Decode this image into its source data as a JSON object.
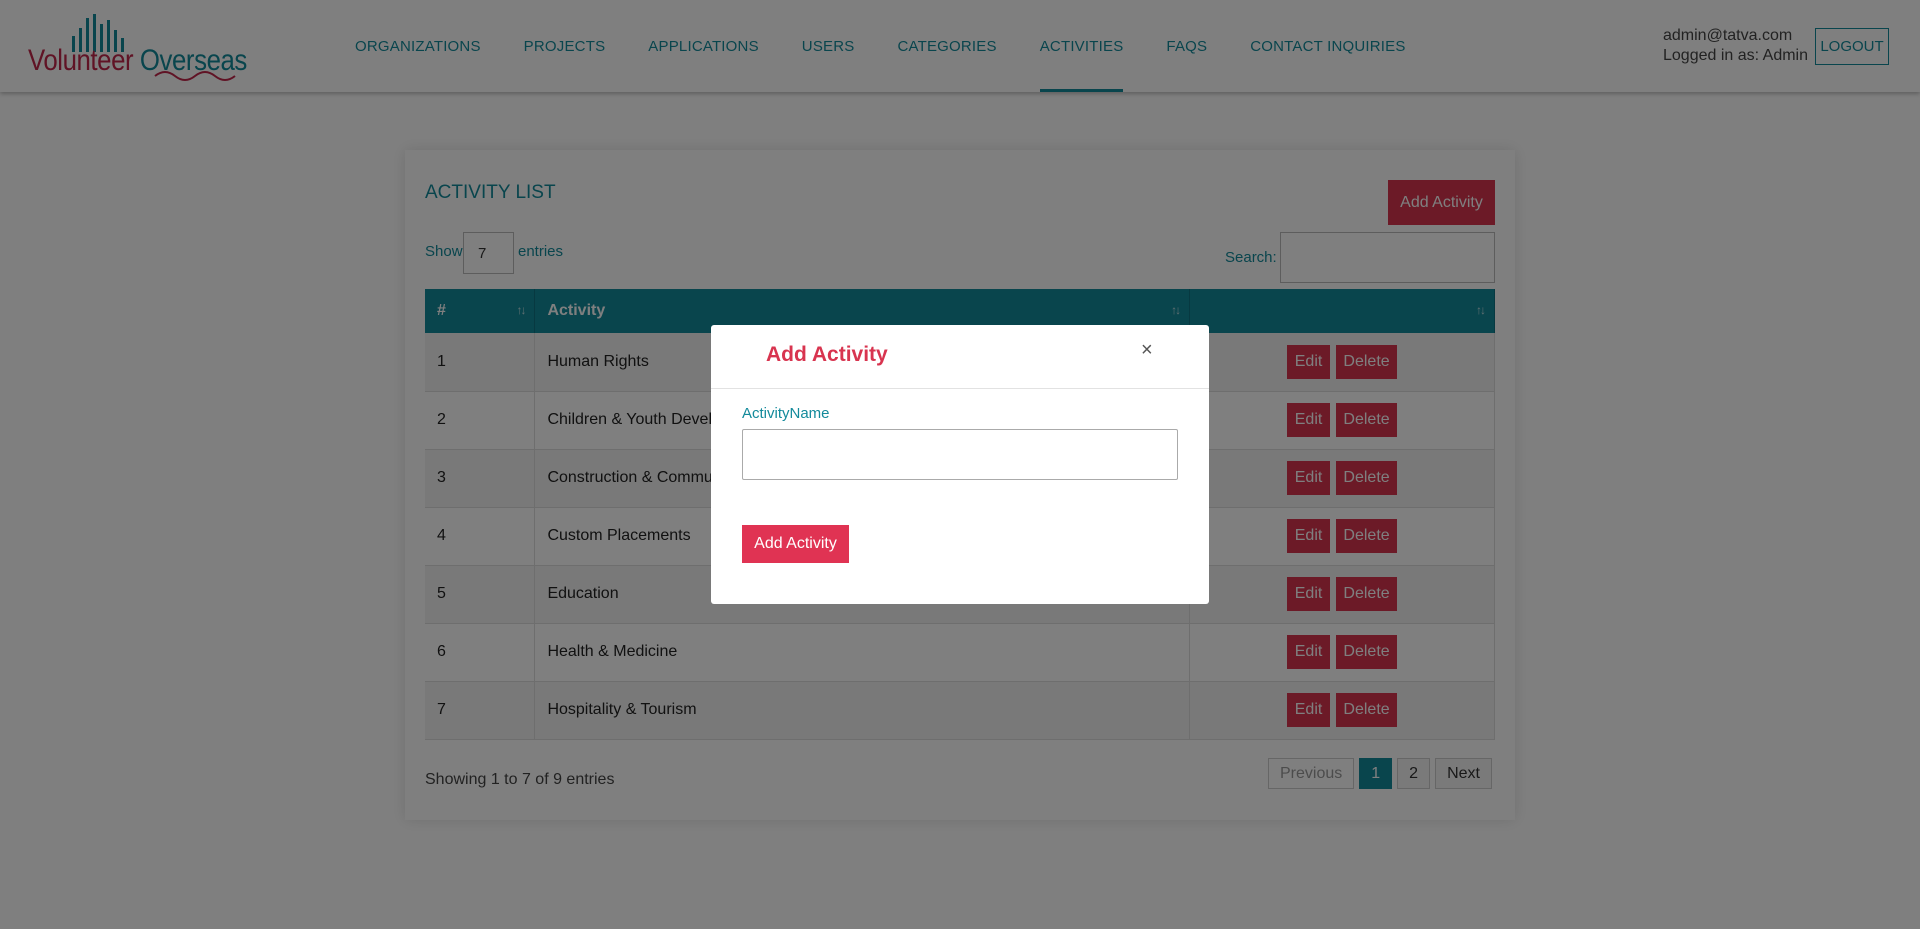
{
  "header": {
    "logo": {
      "word1": "Volunteer",
      "word2": "Overseas"
    },
    "nav": [
      "ORGANIZATIONS",
      "PROJECTS",
      "APPLICATIONS",
      "USERS",
      "CATEGORIES",
      "ACTIVITIES",
      "FAQS",
      "CONTACT INQUIRIES"
    ],
    "active_nav": "ACTIVITIES",
    "user_email": "admin@tatva.com",
    "logged_in_as": "Logged in as: Admin",
    "logout_label": "LOGOUT"
  },
  "list": {
    "title": "ACTIVITY LIST",
    "add_button": "Add Activity",
    "show_label": "Show",
    "page_size": "7",
    "entries_label": "entries",
    "search_label": "Search:",
    "search_value": "",
    "columns": [
      "#",
      "Activity",
      ""
    ],
    "rows": [
      {
        "num": "1",
        "activity": "Human Rights"
      },
      {
        "num": "2",
        "activity": "Children & Youth Development"
      },
      {
        "num": "3",
        "activity": "Construction & Community"
      },
      {
        "num": "4",
        "activity": "Custom Placements"
      },
      {
        "num": "5",
        "activity": "Education"
      },
      {
        "num": "6",
        "activity": "Health & Medicine"
      },
      {
        "num": "7",
        "activity": "Hospitality & Tourism"
      }
    ],
    "edit_label": "Edit",
    "delete_label": "Delete",
    "showing_text": "Showing 1 to 7 of 9 entries",
    "pagination": {
      "previous": "Previous",
      "pages": [
        "1",
        "2"
      ],
      "current": "1",
      "next": "Next"
    }
  },
  "modal": {
    "title": "Add Activity",
    "close_glyph": "×",
    "field_label": "ActivityName",
    "field_value": "",
    "submit_label": "Add Activity"
  },
  "colors": {
    "primary": "#138a9b",
    "accent": "#d8344f"
  }
}
